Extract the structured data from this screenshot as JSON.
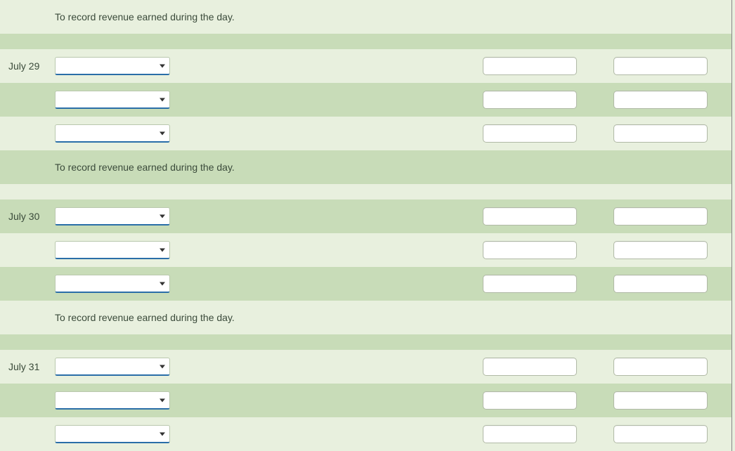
{
  "entries": [
    {
      "date": "",
      "description": "To record revenue earned during the day.",
      "lines": []
    },
    {
      "date": "July 29",
      "description": "To record revenue earned during the day.",
      "lines": [
        {
          "account": "",
          "debit": "",
          "credit": ""
        },
        {
          "account": "",
          "debit": "",
          "credit": ""
        },
        {
          "account": "",
          "debit": "",
          "credit": ""
        }
      ]
    },
    {
      "date": "July 30",
      "description": "To record revenue earned during the day.",
      "lines": [
        {
          "account": "",
          "debit": "",
          "credit": ""
        },
        {
          "account": "",
          "debit": "",
          "credit": ""
        },
        {
          "account": "",
          "debit": "",
          "credit": ""
        }
      ]
    },
    {
      "date": "July 31",
      "description": "",
      "lines": [
        {
          "account": "",
          "debit": "",
          "credit": ""
        },
        {
          "account": "",
          "debit": "",
          "credit": ""
        },
        {
          "account": "",
          "debit": "",
          "credit": ""
        }
      ]
    }
  ]
}
